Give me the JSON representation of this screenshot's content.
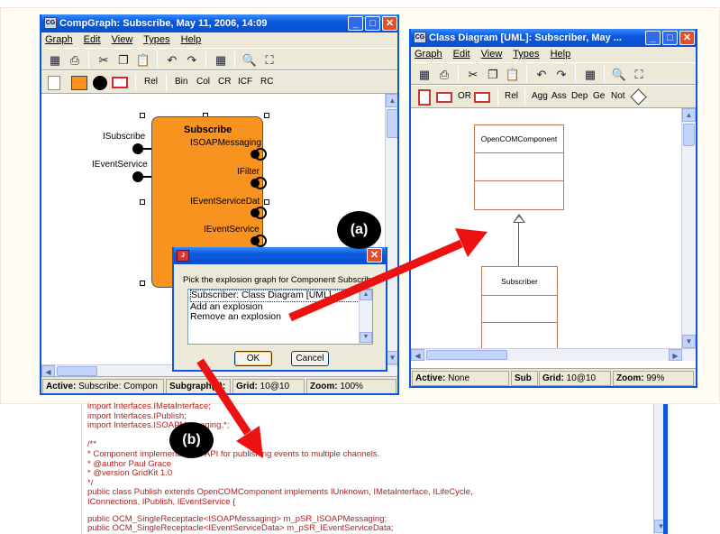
{
  "compgraph": {
    "title": "CompGraph: Subscribe, May 11, 2006, 14:09",
    "icon": "CG",
    "menu": [
      "Graph",
      "Edit",
      "View",
      "Types",
      "Help"
    ],
    "tools2": [
      "Rel",
      "Bin",
      "Col",
      "CR",
      "ICF",
      "RC"
    ],
    "component_name": "Subscribe",
    "interfaces_left": [
      "ISubscribe",
      "IEventService"
    ],
    "interfaces_right": [
      "ISOAPMessaging",
      "IFilter",
      "IEventServiceDat",
      "IEventService"
    ],
    "status": {
      "active": "Active:",
      "active_val": "Subscribe: Compon",
      "subgraph": "Subgraph(s):",
      "grid": "Grid:",
      "grid_val": "10@10",
      "zoom": "Zoom:",
      "zoom_val": "100%"
    }
  },
  "classdiagram": {
    "title": "Class Diagram [UML]: Subscriber, May ...",
    "icon": "CG",
    "menu": [
      "Graph",
      "Edit",
      "View",
      "Types",
      "Help"
    ],
    "tools2": [
      "OR",
      "Rel",
      "Agg",
      "Ass",
      "Dep",
      "Ge",
      "Not"
    ],
    "class_top": "OpenCOMComponent",
    "class_bottom": "Subscriber",
    "status": {
      "active": "Active:",
      "active_val": "None",
      "sub": "Sub",
      "grid": "Grid:",
      "grid_val": "10@10",
      "zoom": "Zoom:",
      "zoom_val": "99%"
    }
  },
  "dialog": {
    "message": "Pick the explosion graph for Component Subscribe",
    "options": [
      "Subscriber: Class Diagram [UML]",
      "Add an explosion",
      "Remove an explosion"
    ],
    "ok": "OK",
    "cancel": "Cancel"
  },
  "labels": {
    "a": "(a)",
    "b": "(b)"
  },
  "code": {
    "lines": [
      "import Interfaces.IMetaInterface;",
      "import Interfaces.IPublish;",
      "import Interfaces.ISOAPMessaging.*;",
      "",
      "/**",
      " * Component implementing an API for publishing events to multiple channels.",
      " * @author  Paul Grace",
      " * @version GridKit  1.0",
      " */",
      "public class Publish extends OpenCOMComponent implements IUnknown, IMetaInterface, ILifeCycle,",
      "IConnections, IPublish, IEventService {",
      "",
      "public OCM_SingleReceptacle<ISOAPMessaging> m_pSR_ISOAPMessaging;",
      "public OCM_SingleReceptacle<IEventServiceData> m_pSR_IEventServiceData;"
    ]
  },
  "colors": {
    "component": "#f7931e",
    "arrow": "#ee1111",
    "titlebar": "#0b58dd",
    "code": "#b21f1f"
  }
}
